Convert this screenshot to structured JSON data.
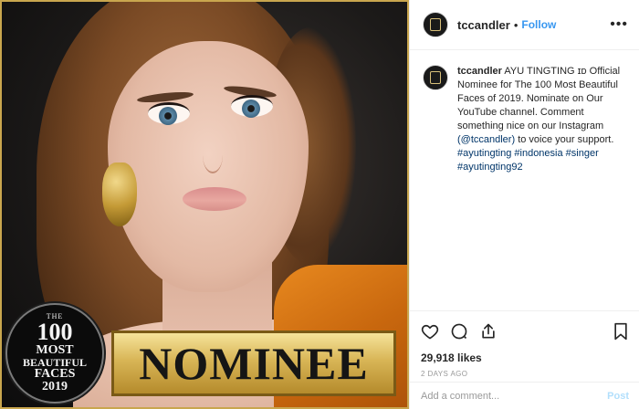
{
  "photo": {
    "seal_lines": [
      "THE",
      "100",
      "MOST",
      "BEAUTIFUL",
      "FACES",
      "2019"
    ],
    "banner_text": "NOMINEE",
    "accent_gold": "#c9a64e"
  },
  "header": {
    "username": "tccandler",
    "separator": "•",
    "follow_label": "Follow",
    "more_icon": "more-horizontal-icon"
  },
  "caption": {
    "username": "tccandler",
    "body": "AYU TINGTING ɪᴅ Official Nominee for The 100 Most Beautiful Faces of 2019. Nominate on Our YouTube channel. Comment something nice on our Instagram",
    "mention": "(@tccandler)",
    "body2": "to voice your support.",
    "hashtags": [
      "#ayutingting",
      "#indonesia",
      "#singer",
      "#ayutingting92"
    ]
  },
  "actions": {
    "likes": "29,918 likes",
    "date": "2 DAYS AGO",
    "icons": [
      "heart-icon",
      "comment-icon",
      "share-icon",
      "bookmark-icon"
    ]
  },
  "comment_box": {
    "placeholder": "Add a comment...",
    "post_label": "Post"
  },
  "colors": {
    "link_blue": "#3897f0",
    "hashtag": "#003569",
    "post_disabled": "#b2dffc"
  }
}
